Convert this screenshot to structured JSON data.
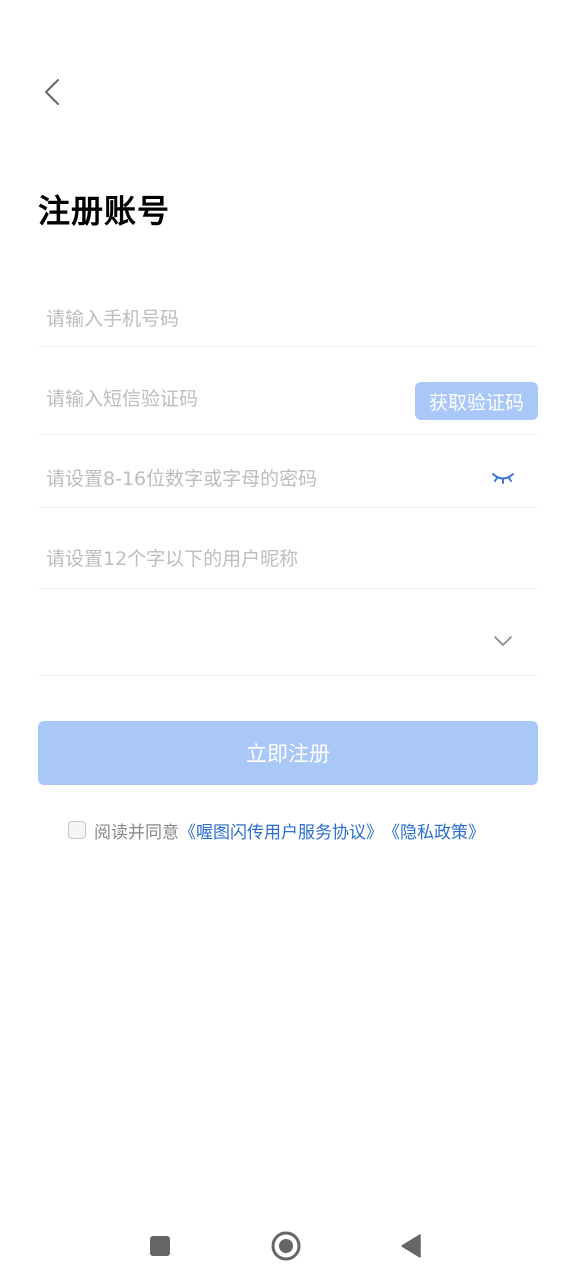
{
  "header": {
    "back_icon": "chevron-left-icon",
    "title": "注册账号"
  },
  "form": {
    "phone_placeholder": "请输入手机号码",
    "code_placeholder": "请输入短信验证码",
    "get_code_label": "获取验证码",
    "password_placeholder": "请设置8-16位数字或字母的密码",
    "password_toggle_icon": "eye-closed-icon",
    "nickname_placeholder": "请设置12个字以下的用户昵称",
    "select_value": "",
    "select_icon": "chevron-down-icon",
    "submit_label": "立即注册"
  },
  "agreement": {
    "checked": false,
    "prefix": "阅读并同意",
    "terms_link": "《喔图闪传用户服务协议》",
    "privacy_link": "《隐私政策》"
  },
  "navbar": {
    "recents_icon": "square-icon",
    "home_icon": "circle-icon",
    "back_icon": "triangle-back-icon"
  },
  "colors": {
    "accent_disabled": "#a9c7f7",
    "link": "#2a6fcf",
    "placeholder": "#bdbdbd",
    "divider": "#eeeeee"
  }
}
